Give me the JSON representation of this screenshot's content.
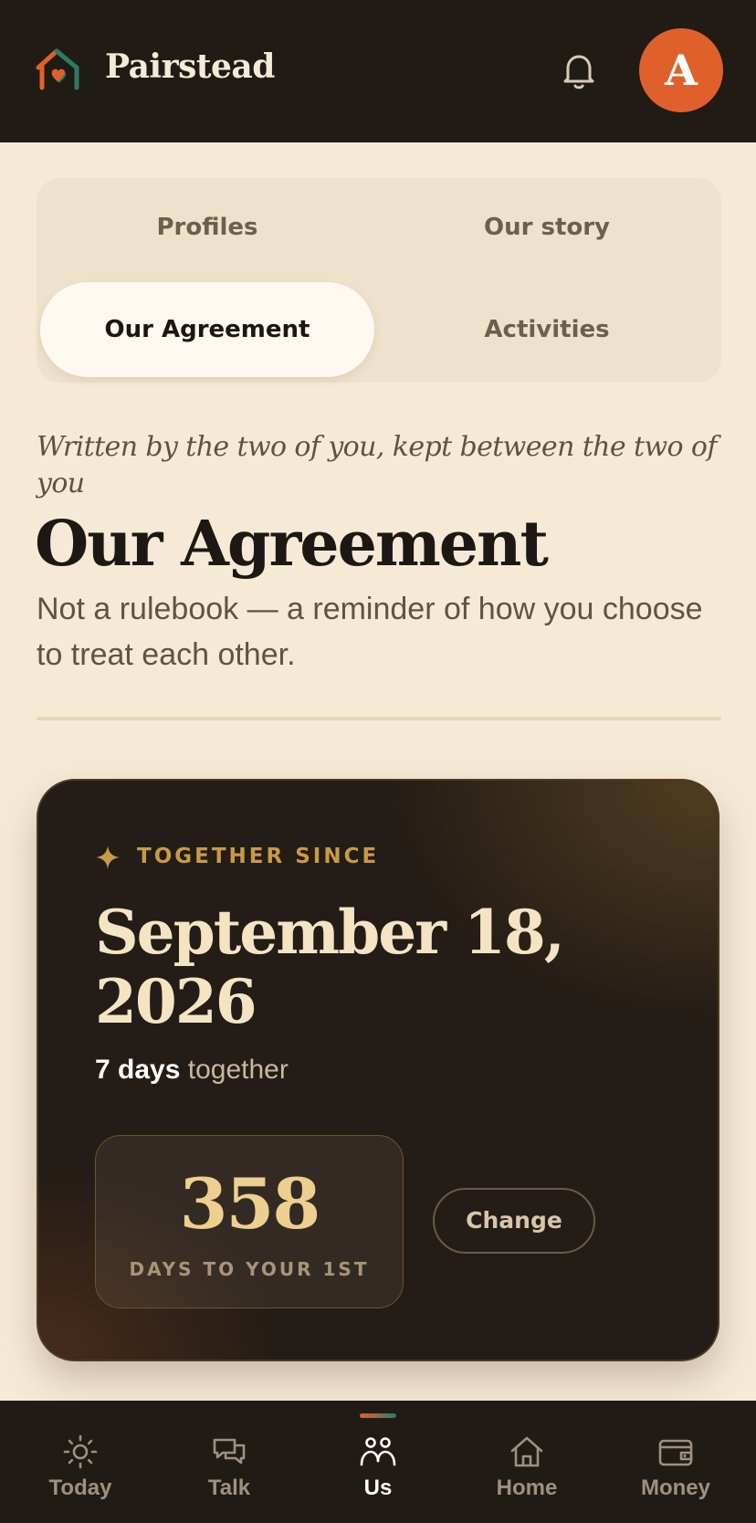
{
  "app": {
    "name": "Pairstead"
  },
  "header": {
    "avatar_initial": "A"
  },
  "tabs": [
    {
      "label": "Profiles",
      "active": false
    },
    {
      "label": "Our story",
      "active": false
    },
    {
      "label": "Our Agreement",
      "active": true
    },
    {
      "label": "Activities",
      "active": false
    }
  ],
  "intro": {
    "eyebrow": "Written by the two of you, kept between the two of you",
    "title": "Our Agreement",
    "subtitle": "Not a rulebook — a reminder of how you choose to treat each other."
  },
  "together_card": {
    "label": "TOGETHER SINCE",
    "date": "September 18, 2026",
    "days_count": "7 days",
    "days_suffix": "together",
    "countdown_number": "358",
    "countdown_label": "DAYS TO YOUR 1ST",
    "change_button": "Change"
  },
  "bottom_nav": [
    {
      "label": "Today",
      "icon": "sun-icon",
      "active": false
    },
    {
      "label": "Talk",
      "icon": "chat-icon",
      "active": false
    },
    {
      "label": "Us",
      "icon": "people-icon",
      "active": true
    },
    {
      "label": "Home",
      "icon": "home-icon",
      "active": false
    },
    {
      "label": "Money",
      "icon": "wallet-icon",
      "active": false
    }
  ],
  "colors": {
    "header_bg": "#211b16",
    "page_bg": "#f6ead7",
    "accent_orange": "#e0602c",
    "accent_green": "#2f7a63",
    "gold": "#c99a45"
  }
}
